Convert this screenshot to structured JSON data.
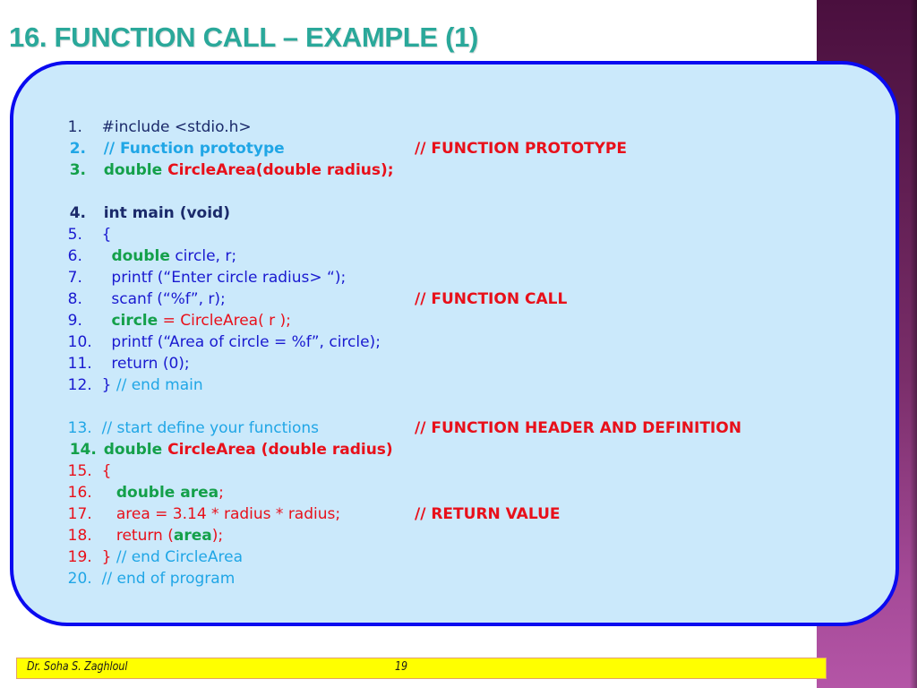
{
  "slide": {
    "title": "16. FUNCTION CALL – EXAMPLE (1)",
    "colors": {
      "title": "#2aa89a",
      "box_fill": "#cbe9fb",
      "box_border": "#0a0af0",
      "side_band": "#7a2e6a",
      "footer_bar": "#ffff00"
    }
  },
  "code": {
    "lines": [
      {
        "num": "1.",
        "tokens": [
          "#include <stdio.h>"
        ]
      },
      {
        "num": "2.",
        "tokens": [
          "// Function prototype"
        ]
      },
      {
        "num": "3.",
        "tokens": [
          "double ",
          "CircleArea(double radius);"
        ]
      },
      {
        "num": "4.",
        "tokens": [
          "int main (void)"
        ]
      },
      {
        "num": "5.",
        "tokens": [
          "{"
        ]
      },
      {
        "num": "6.",
        "tokens": [
          "  ",
          "double",
          " circle, r;"
        ]
      },
      {
        "num": "7.",
        "tokens": [
          "  printf (“Enter circle radius> “);"
        ]
      },
      {
        "num": "8.",
        "tokens": [
          "  scanf (“%f”, r);"
        ]
      },
      {
        "num": "9.",
        "tokens": [
          "  ",
          "circle",
          " = CircleArea( r );"
        ]
      },
      {
        "num": "10.",
        "tokens": [
          "  printf (“Area of circle = %f”, circle);"
        ]
      },
      {
        "num": "11.",
        "tokens": [
          "  return (0);"
        ]
      },
      {
        "num": "12.",
        "tokens": [
          "} ",
          "// end main"
        ]
      },
      {
        "num": "13.",
        "tokens": [
          "// start define your functions"
        ]
      },
      {
        "num": "14.",
        "tokens": [
          "double ",
          "CircleArea (double radius)"
        ]
      },
      {
        "num": "15.",
        "tokens": [
          "{"
        ]
      },
      {
        "num": "16.",
        "tokens": [
          "   ",
          "double area",
          ";"
        ]
      },
      {
        "num": "17.",
        "tokens": [
          "   area = 3.14 * radius * radius;"
        ]
      },
      {
        "num": "18.",
        "tokens": [
          "   return (",
          "area",
          ");"
        ]
      },
      {
        "num": "19.",
        "tokens": [
          "} ",
          "// end CircleArea"
        ]
      },
      {
        "num": "20.",
        "tokens": [
          "// end of program"
        ]
      }
    ],
    "annotations": {
      "prototype": "// FUNCTION PROTOTYPE",
      "call": "// FUNCTION CALL",
      "definition": "// FUNCTION HEADER AND DEFINITION",
      "return": "// RETURN VALUE"
    }
  },
  "footer": {
    "author": "Dr. Soha S. Zaghloul",
    "page": "19"
  }
}
